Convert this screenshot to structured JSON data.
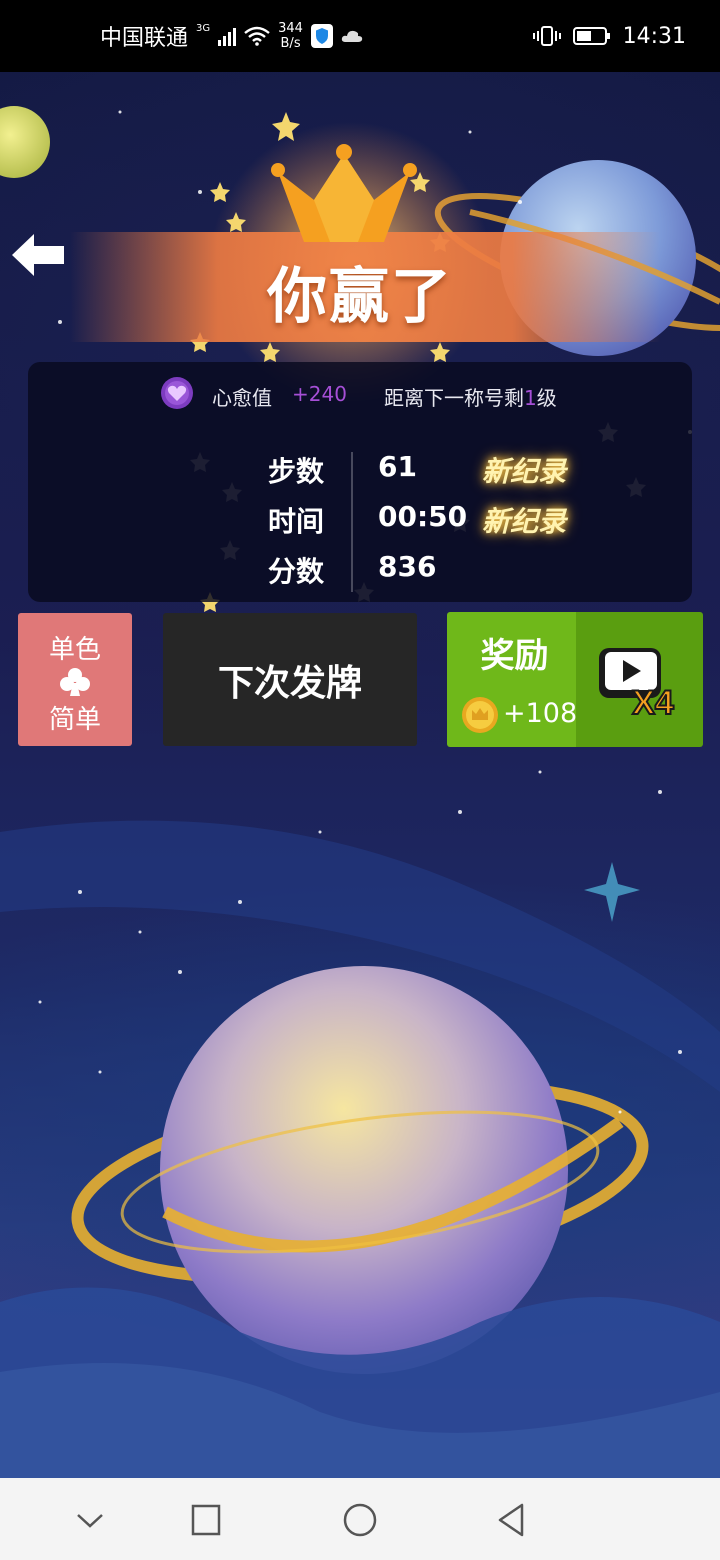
{
  "status_bar": {
    "carrier": "中国联通",
    "network_type": "3G",
    "speed_value": "344",
    "speed_unit": "B/s",
    "time": "14:31",
    "icons": [
      "signal-icon",
      "wifi-icon",
      "shield-icon",
      "cloud-icon",
      "vibrate-icon",
      "battery-icon"
    ]
  },
  "result": {
    "title": "你赢了",
    "heal": {
      "label": "心愈值",
      "plus": "+240",
      "next_title_prefix": "距离下一称号剩",
      "next_title_levels": "1",
      "next_title_suffix": "级"
    },
    "stats": [
      {
        "label": "步数",
        "value": "61",
        "badge": "新纪录"
      },
      {
        "label": "时间",
        "value": "00:50",
        "badge": "新纪录"
      },
      {
        "label": "分数",
        "value": "836",
        "badge": ""
      }
    ]
  },
  "actions": {
    "mode": {
      "line1": "单色",
      "suit": "club-icon",
      "line2": "简单"
    },
    "next_deal": "下次发牌",
    "reward": {
      "title": "奖励",
      "amount": "+108",
      "multiplier": "X4"
    }
  },
  "nav": [
    "collapse-icon",
    "recents-icon",
    "home-icon",
    "back-icon"
  ],
  "colors": {
    "accent_purple": "#a64fd6",
    "mode_button": "#e07878",
    "next_button": "#262626",
    "reward_green": "#6fb81a",
    "banner_orange": "#ec7a42",
    "crown_orange": "#f5a020"
  }
}
